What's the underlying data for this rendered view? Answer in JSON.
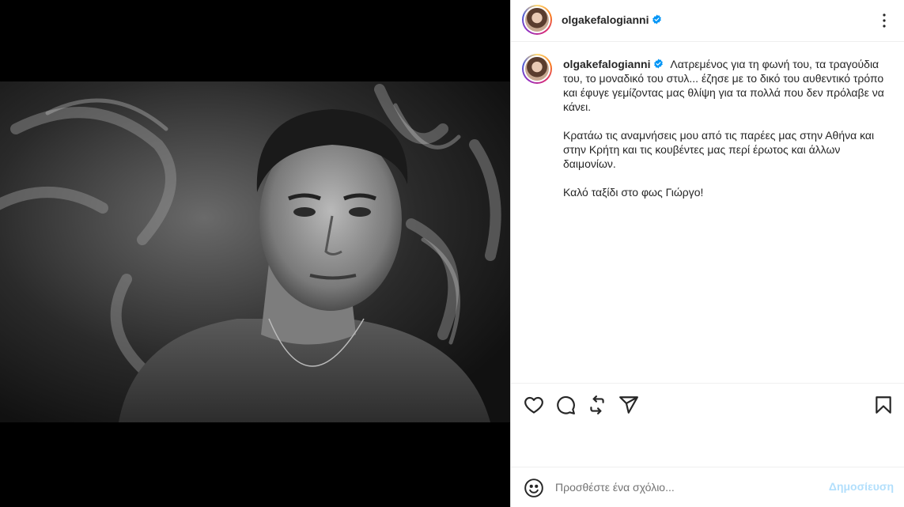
{
  "post": {
    "username": "olgakefalogianni",
    "verified": true
  },
  "caption": {
    "username": "olgakefalogianni",
    "paragraph1": "Λατρεμένος για τη φωνή του, τα τραγούδια του, το μοναδικό του στυλ... έζησε με το δικό του αυθεντικό τρόπο και έφυγε γεμίζοντας μας θλίψη για τα πολλά που δεν πρόλαβε να κάνει.",
    "paragraph2": "Κρατάω τις αναμνήσεις μου από τις παρέες μας στην Αθήνα και στην Κρήτη και τις κουβέντες μας περί έρωτος και άλλων δαιμονίων.",
    "paragraph3": "Καλό ταξίδι στο φως Γιώργο!"
  },
  "actions": {
    "icons": [
      "heart-icon",
      "comment-icon",
      "repost-icon",
      "share-icon",
      "bookmark-icon"
    ]
  },
  "comment": {
    "placeholder": "Προσθέστε ένα σχόλιο...",
    "post_label": "Δημοσίευση"
  },
  "colors": {
    "verified_blue": "#0095f6",
    "post_button_disabled": "#b2dffc",
    "text_primary": "#262626"
  }
}
